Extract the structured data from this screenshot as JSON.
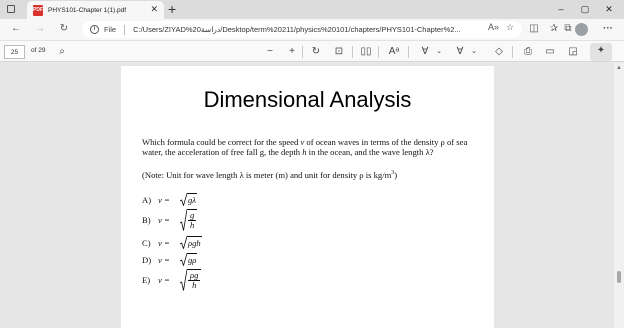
{
  "tab": {
    "title": "PHYS101-Chapter 1(1).pdf",
    "close": "✕",
    "new": "+"
  },
  "window": {
    "minimize": "–",
    "maximize": "▢",
    "close": "✕"
  },
  "address": {
    "scheme_label": "File",
    "url": "C:/Users/ZIYAD%20دراسة/Desktop/term%20211/physics%20101/chapters/PHYS101-Chapter%2..."
  },
  "pdf_toolbar": {
    "page_current": "25",
    "page_total": "of 29"
  },
  "document": {
    "title": "Dimensional Analysis",
    "question_parts": [
      "Which formula could be correct for the speed ",
      "v",
      " of ocean waves in terms of the density ρ of sea water, the acceleration of free fall g, the depth ",
      "h",
      " in the ocean, and the wave length λ?"
    ],
    "note": "(Note: Unit for wave length λ is meter (m) and unit for density ρ is kg/m",
    "note_exp": "3",
    "note_end": ")",
    "options": [
      {
        "letter": "A)",
        "lhs": "v =",
        "expr": "gλ"
      },
      {
        "letter": "B)",
        "lhs": "v =",
        "num": "g",
        "den": "h"
      },
      {
        "letter": "C)",
        "lhs": "v =",
        "expr": "ρgh"
      },
      {
        "letter": "D)",
        "lhs": "v =",
        "expr": "gρ"
      },
      {
        "letter": "E)",
        "lhs": "v =",
        "num": "ρg",
        "den": "h"
      }
    ]
  },
  "icons": [
    "pdf-file-icon",
    "back-arrow-icon",
    "forward-arrow-icon",
    "refresh-icon",
    "info-icon",
    "read-aloud-icon",
    "favorite-star-icon",
    "split-screen-icon",
    "favorites-icon",
    "collections-icon",
    "profile-avatar",
    "more-icon",
    "search-icon",
    "zoom-out-icon",
    "zoom-in-icon",
    "rotate-icon",
    "fit-page-icon",
    "page-view-icon",
    "text-size-icon",
    "draw-icon",
    "highlight-icon",
    "eraser-icon",
    "print-icon",
    "save-icon",
    "save-as-icon",
    "pin-icon"
  ]
}
